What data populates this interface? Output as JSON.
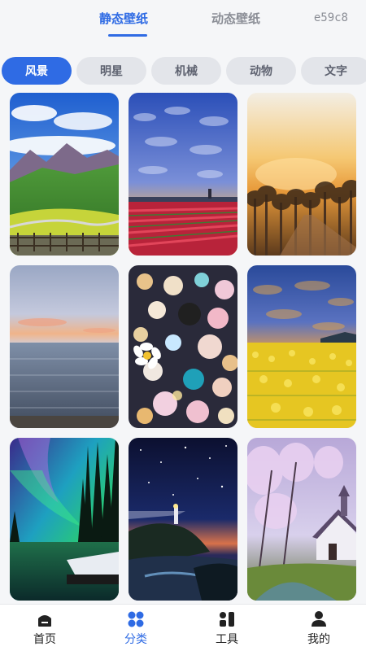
{
  "header": {
    "tabs": [
      {
        "label": "静态壁纸",
        "active": true
      },
      {
        "label": "动态壁纸",
        "active": false
      }
    ],
    "extra_text": "e59c8"
  },
  "categories": [
    {
      "label": "风景",
      "active": true
    },
    {
      "label": "明星",
      "active": false
    },
    {
      "label": "机械",
      "active": false
    },
    {
      "label": "动物",
      "active": false
    },
    {
      "label": "文字",
      "active": false
    }
  ],
  "wallpapers": [
    {
      "subject": "mountain-meadow"
    },
    {
      "subject": "tulip-field-sunset"
    },
    {
      "subject": "foggy-sunrise-trees"
    },
    {
      "subject": "calm-sea-dusk"
    },
    {
      "subject": "glowing-pebbles-flower"
    },
    {
      "subject": "rapeseed-field-sunset"
    },
    {
      "subject": "aurora-forest-lake"
    },
    {
      "subject": "lighthouse-starry-night"
    },
    {
      "subject": "cherry-blossom-cabin"
    }
  ],
  "bottom_nav": [
    {
      "label": "首页",
      "icon": "home-icon",
      "active": false
    },
    {
      "label": "分类",
      "icon": "category-icon",
      "active": true
    },
    {
      "label": "工具",
      "icon": "tools-icon",
      "active": false
    },
    {
      "label": "我的",
      "icon": "user-icon",
      "active": false
    }
  ],
  "colors": {
    "accent": "#2f6be4",
    "chip_bg": "#e3e5ea",
    "page_bg": "#f5f6f8"
  }
}
